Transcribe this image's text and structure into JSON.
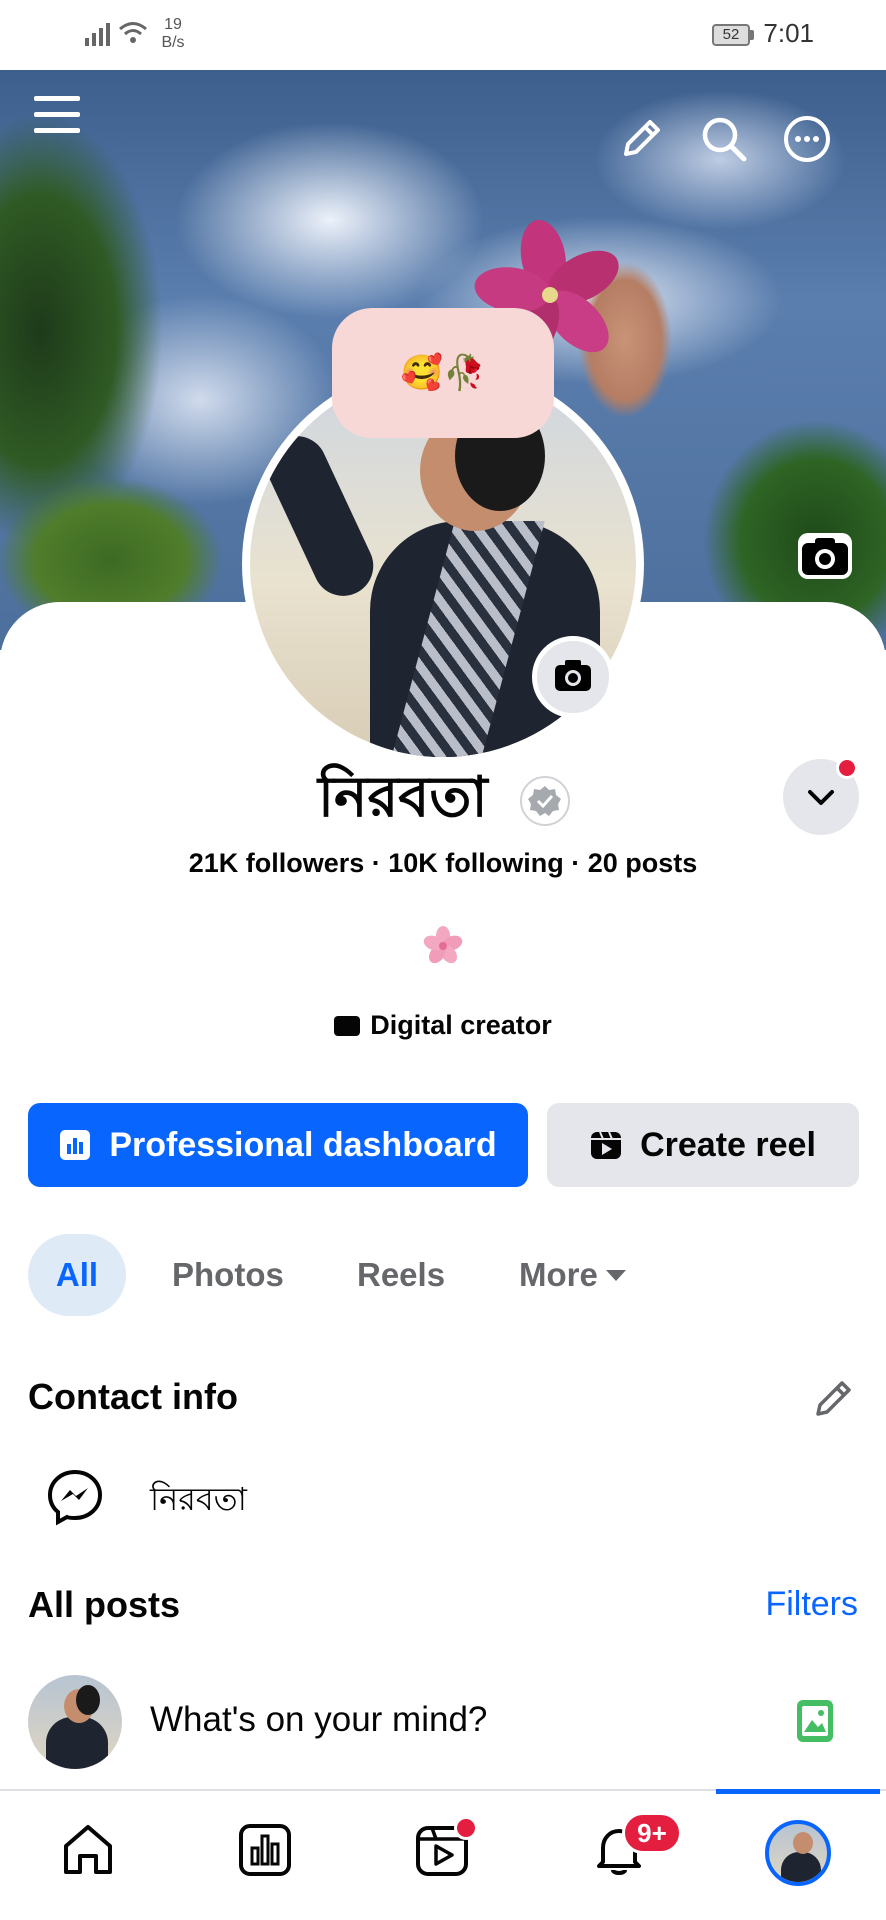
{
  "status_bar": {
    "net_speed_value": "19",
    "net_speed_unit": "B/s",
    "battery": "52",
    "time": "7:01"
  },
  "cover": {
    "icons": [
      "menu-icon",
      "pencil-icon",
      "search-icon",
      "more-icon",
      "camera-icon"
    ]
  },
  "profile": {
    "avatar_sticker": "🥰🥀",
    "name": "নিরবতা",
    "stats": "21K followers · 10K following · 20 posts",
    "bio_emoji": "🌸",
    "category": "Digital creator"
  },
  "actions": {
    "primary_label": "Professional dashboard",
    "secondary_label": "Create reel",
    "primary_color": "#0866ff"
  },
  "tabs": [
    {
      "label": "All",
      "active": true
    },
    {
      "label": "Photos",
      "active": false
    },
    {
      "label": "Reels",
      "active": false
    },
    {
      "label": "More",
      "active": false
    }
  ],
  "contact": {
    "title": "Contact info",
    "messenger_value": "নিরবতা"
  },
  "posts": {
    "title": "All posts",
    "filters_label": "Filters",
    "composer_placeholder": "What's on your mind?"
  },
  "bottom_nav": {
    "items": [
      "home-icon",
      "dashboard-icon",
      "reels-icon",
      "notifications-icon",
      "profile-avatar"
    ],
    "notifications_badge": "9+"
  }
}
